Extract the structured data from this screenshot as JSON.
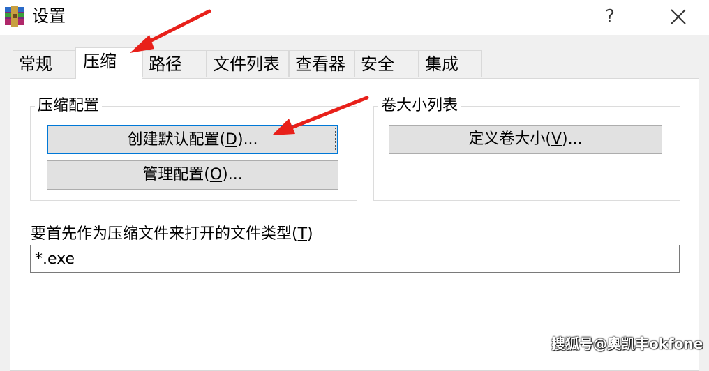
{
  "window": {
    "title": "设置",
    "icon": "winrar-icon",
    "help_label": "?",
    "close_icon": "close-icon"
  },
  "tabs": [
    {
      "label": "常规",
      "active": false
    },
    {
      "label": "压缩",
      "active": true
    },
    {
      "label": "路径",
      "active": false
    },
    {
      "label": "文件列表",
      "active": false
    },
    {
      "label": "查看器",
      "active": false
    },
    {
      "label": "安全",
      "active": false
    },
    {
      "label": "集成",
      "active": false
    }
  ],
  "compression_profiles": {
    "legend": "压缩配置",
    "create_default_prefix": "创建默认配置(",
    "create_default_key": "D",
    "create_default_suffix": ")...",
    "manage_prefix": "管理配置(",
    "manage_key": "O",
    "manage_suffix": ")..."
  },
  "volume_sizes": {
    "legend": "卷大小列表",
    "define_prefix": "定义卷大小(",
    "define_key": "V",
    "define_suffix": ")..."
  },
  "archive_types": {
    "label_prefix": "要首先作为压缩文件来打开的文件类型(",
    "label_key": "T",
    "label_suffix": ")",
    "value": "*.exe"
  },
  "annotation_color": "#e8201a",
  "watermark": "搜狐号@奥凯丰okfone"
}
